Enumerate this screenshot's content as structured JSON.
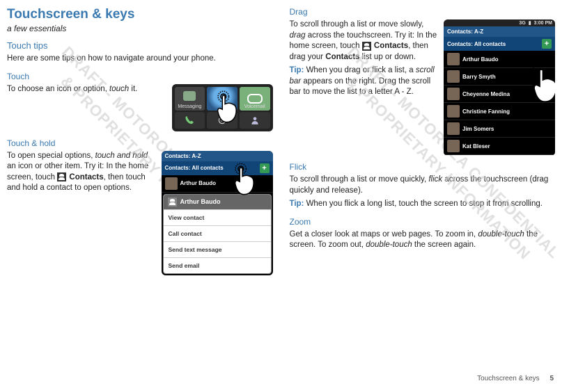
{
  "page": {
    "title": "Touchscreen & keys",
    "subtitle": "a few essentials",
    "footer_section": "Touchscreen & keys",
    "footer_page": "5"
  },
  "left": {
    "tips_heading": "Touch tips",
    "tips_intro": "Here are some tips on how to navigate around your phone.",
    "touch_heading": "Touch",
    "touch_body_a": "To choose an icon or option, ",
    "touch_body_b": "touch",
    "touch_body_c": " it.",
    "hold_heading": "Touch & hold",
    "hold_body_a": "To open special options, ",
    "hold_body_b": "touch and hold",
    "hold_body_c": " an icon or other item. Try it: In the home screen, touch ",
    "hold_contacts": " Contacts",
    "hold_body_d": ", then touch and hold a contact to open options.",
    "tray": {
      "messaging": "Messaging",
      "voicemail": "Voicemail"
    },
    "popup": {
      "header": "Contacts: A-Z",
      "subheader": "Contacts: All contacts",
      "row_partial": "Arthur Baudo",
      "title": "Arthur Baudo",
      "items": [
        "View contact",
        "Call contact",
        "Send text message",
        "Send email"
      ]
    }
  },
  "right": {
    "drag_heading": "Drag",
    "drag_body_a": "To scroll through a list or move slowly, ",
    "drag_body_b": "drag",
    "drag_body_c": " across the touchscreen. Try it: In the home screen, touch ",
    "drag_contacts": " Contacts",
    "drag_body_d": ", then drag your ",
    "drag_contacts_bold": "Contacts",
    "drag_body_e": " list up or down.",
    "drag_tip_label": "Tip:",
    "drag_tip_a": " When you drag or flick a list, a ",
    "drag_tip_b": "scroll bar",
    "drag_tip_c": " appears on the right. Drag the scroll bar to move the list to a letter A - Z.",
    "flick_heading": "Flick",
    "flick_body_a": "To scroll through a list or move quickly, ",
    "flick_body_b": "flick",
    "flick_body_c": " across the touchscreen (drag quickly and release).",
    "flick_tip_label": "Tip:",
    "flick_tip": " When you flick a long list, touch the screen to stop it from scrolling.",
    "zoom_heading": "Zoom",
    "zoom_body_a": "Get a closer look at maps or web pages. To zoom in, ",
    "zoom_body_b": "double-touch",
    "zoom_body_c": " the screen. To zoom out, ",
    "zoom_body_d": "double-touch",
    "zoom_body_e": " the screen again.",
    "list": {
      "status_time": "3:00 PM",
      "status_net": "3G",
      "header": "Contacts: A-Z",
      "subheader": "Contacts: All contacts",
      "rows": [
        "Arthur Baudo",
        "Barry Smyth",
        "Cheyenne Medina",
        "Christine Fanning",
        "Jim Somers",
        "Kat Bleser"
      ]
    }
  }
}
